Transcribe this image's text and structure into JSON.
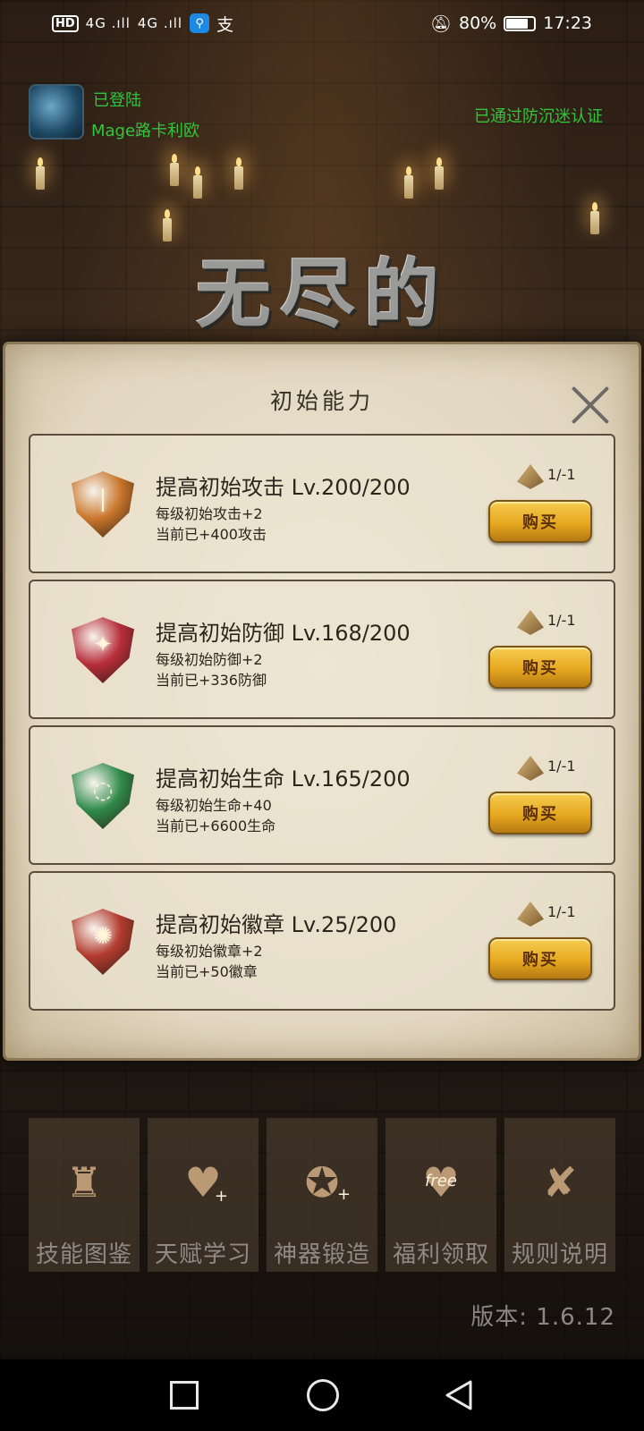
{
  "status_bar": {
    "hd": "HD",
    "signal_1": "4G .ıll",
    "signal_2": "4G .ıll",
    "app_icon": "search-app-icon",
    "alipay": "支",
    "battery_pct": "80%",
    "battery_level": 0.8,
    "time": "17:23"
  },
  "login": {
    "status": "已登陆",
    "name": "Mage路卡利欧",
    "anti_addiction": "已通过防沉迷认证"
  },
  "game_title": "无尽的",
  "dialog": {
    "title": "初始能力",
    "close_icon": "close-icon",
    "items": [
      {
        "icon": "attack-gem-icon",
        "gem_color": "#c9762b",
        "symbol": "❘",
        "name": "提高初始攻击 Lv.200/200",
        "desc": "每级初始攻击+2",
        "current": "当前已+400攻击",
        "cost": "1/-1",
        "buy_label": "购买"
      },
      {
        "icon": "defense-gem-icon",
        "gem_color": "#b72d3a",
        "symbol": "✦",
        "name": "提高初始防御 Lv.168/200",
        "desc": "每级初始防御+2",
        "current": "当前已+336防御",
        "cost": "1/-1",
        "buy_label": "购买"
      },
      {
        "icon": "life-gem-icon",
        "gem_color": "#2f8a4a",
        "symbol": "◌",
        "name": "提高初始生命 Lv.165/200",
        "desc": "每级初始生命+40",
        "current": "当前已+6600生命",
        "cost": "1/-1",
        "buy_label": "购买"
      },
      {
        "icon": "badge-gem-icon",
        "gem_color": "#b23b2e",
        "symbol": "✺",
        "name": "提高初始徽章 Lv.25/200",
        "desc": "每级初始徽章+2",
        "current": "当前已+50徽章",
        "cost": "1/-1",
        "buy_label": "购买"
      }
    ]
  },
  "menu": [
    {
      "label": "技能图鉴",
      "icon": "skill-book-icon",
      "glyph": "♜",
      "badge": ""
    },
    {
      "label": "天赋学习",
      "icon": "heart-plus-icon",
      "glyph": "♥",
      "badge": "+"
    },
    {
      "label": "神器锻造",
      "icon": "artifact-forge-icon",
      "glyph": "✪",
      "badge": "+"
    },
    {
      "label": "福利领取",
      "icon": "free-heart-icon",
      "glyph": "♥",
      "badge": "free"
    },
    {
      "label": "规则说明",
      "icon": "rules-scroll-icon",
      "glyph": "✘",
      "badge": ""
    }
  ],
  "version": "版本: 1.6.12",
  "nav": {
    "recent_icon": "recent-apps-icon",
    "home_icon": "home-icon",
    "back_icon": "back-icon"
  }
}
